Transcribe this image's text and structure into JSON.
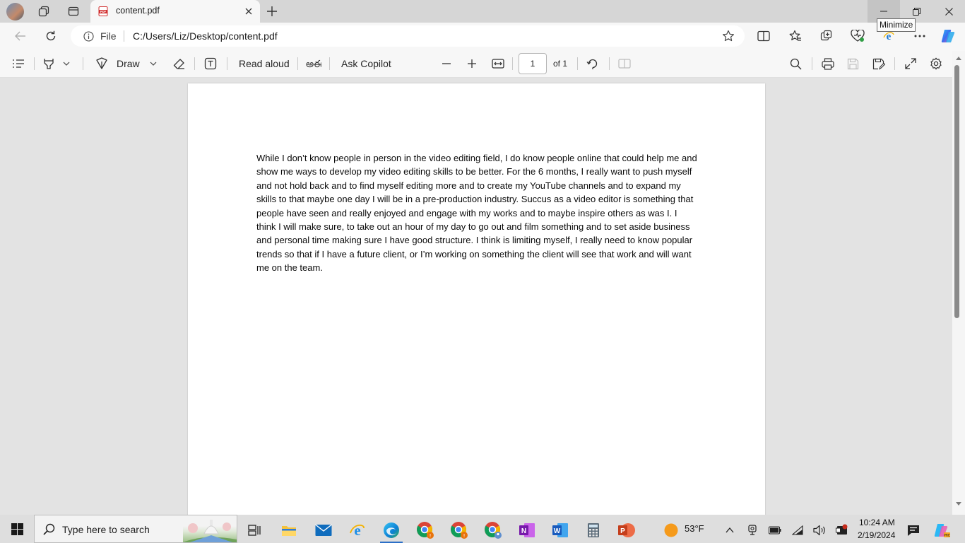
{
  "browser": {
    "tab": {
      "title": "content.pdf",
      "favicon": "pdf-icon",
      "close_icon": "close-icon"
    },
    "window_tooltip": "Minimize",
    "address": {
      "site_label": "File",
      "url": "C:/Users/Liz/Desktop/content.pdf"
    }
  },
  "pdf_toolbar": {
    "draw_label": "Draw",
    "read_aloud_label": "Read aloud",
    "ask_copilot_label": "Ask Copilot",
    "page_number": "1",
    "page_total": "of 1"
  },
  "document": {
    "paragraph": "While I don’t know people in person in the video editing field, I do know people online that could help me and show me ways to develop my video editing skills to be better. For the 6 months, I really want to push myself and not hold back and to find myself editing more and to create my YouTube channels and to expand my skills to that maybe one day I will be in a pre-production industry. Succus as a video editor is something that people have seen and really enjoyed and engage with my works and to maybe inspire others as was I. I think I will make sure, to take out an hour of my day to go out and film something and to set aside business and personal time making sure I have good structure. I think is limiting myself, I really need to know popular trends so that if I have a future client, or I’m working on something the client will see that work and will want me on the team."
  },
  "taskbar": {
    "search_placeholder": "Type here to search",
    "weather": "53°F",
    "time": "10:24 AM",
    "date": "2/19/2024"
  },
  "colors": {
    "accent": "#0f6cbd",
    "pdf_red": "#d23232",
    "taskbar": "#dedede"
  }
}
